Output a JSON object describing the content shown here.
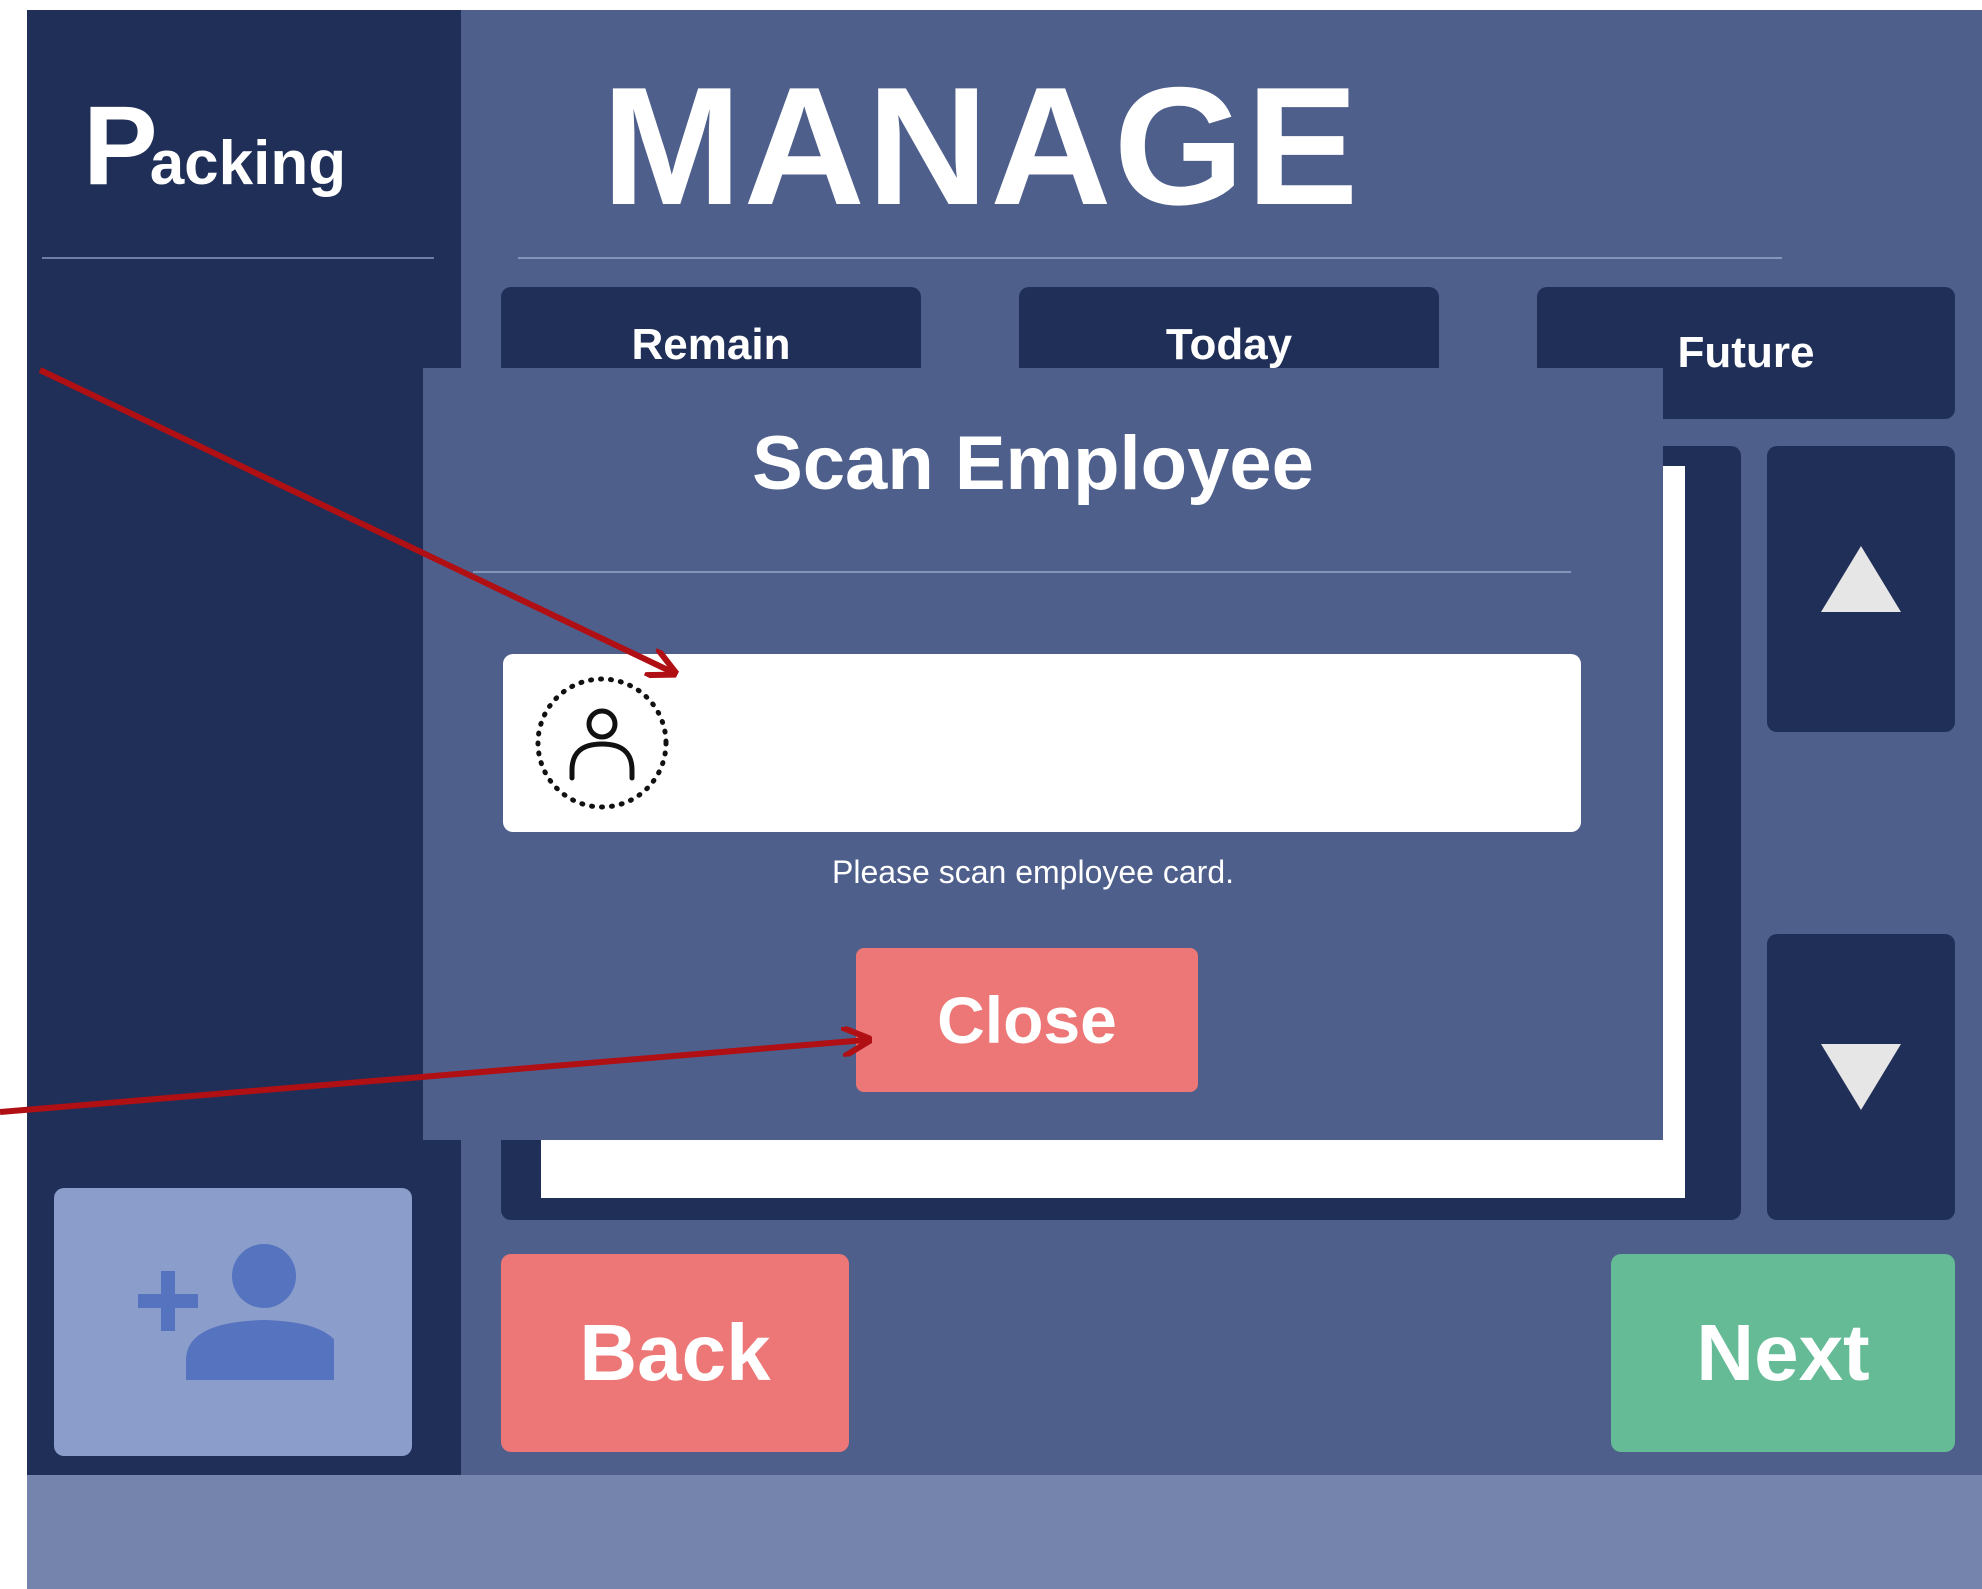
{
  "sidebar": {
    "logo_initial": "P",
    "logo_rest": "acking",
    "add_user_icon": "person-add-icon"
  },
  "header": {
    "title": "MANAGE"
  },
  "tabs": [
    {
      "label": "Remain"
    },
    {
      "label": "Today"
    },
    {
      "label": "Future"
    }
  ],
  "scroll": {
    "up_icon": "triangle-up-icon",
    "down_icon": "triangle-down-icon"
  },
  "actions": {
    "back_label": "Back",
    "next_label": "Next"
  },
  "modal": {
    "title": "Scan Employee",
    "scan_input_value": "",
    "scan_icon": "person-scan-icon",
    "hint": "Please scan employee card.",
    "close_label": "Close"
  },
  "colors": {
    "sidebar_bg": "#202f57",
    "main_bg": "#4e5f8c",
    "back_red": "#ec7776",
    "next_green": "#64bb96",
    "add_user_bg": "#8a9dcb",
    "annotation_arrow": "#b00f14"
  }
}
